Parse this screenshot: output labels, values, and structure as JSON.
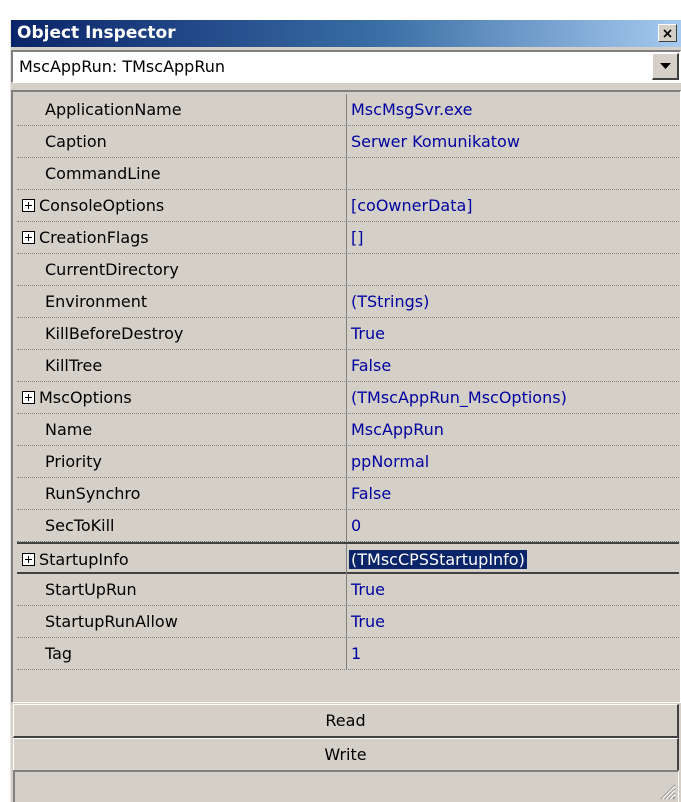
{
  "window": {
    "title": "Object Inspector"
  },
  "component_selector": {
    "value": "MscAppRun: TMscAppRun"
  },
  "properties": [
    {
      "name": "ApplicationName",
      "value": "MscMsgSvr.exe",
      "expandable": false
    },
    {
      "name": "Caption",
      "value": "Serwer Komunikatow",
      "expandable": false
    },
    {
      "name": "CommandLine",
      "value": "",
      "expandable": false
    },
    {
      "name": "ConsoleOptions",
      "value": "[coOwnerData]",
      "expandable": true
    },
    {
      "name": "CreationFlags",
      "value": "[]",
      "expandable": true
    },
    {
      "name": "CurrentDirectory",
      "value": "",
      "expandable": false
    },
    {
      "name": "Environment",
      "value": "(TStrings)",
      "expandable": false
    },
    {
      "name": "KillBeforeDestroy",
      "value": "True",
      "expandable": false
    },
    {
      "name": "KillTree",
      "value": "False",
      "expandable": false
    },
    {
      "name": "MscOptions",
      "value": "(TMscAppRun_MscOptions)",
      "expandable": true
    },
    {
      "name": "Name",
      "value": "MscAppRun",
      "expandable": false
    },
    {
      "name": "Priority",
      "value": "ppNormal",
      "expandable": false
    },
    {
      "name": "RunSynchro",
      "value": "False",
      "expandable": false
    },
    {
      "name": "SecToKill",
      "value": "0",
      "expandable": false
    },
    {
      "name": "StartupInfo",
      "value": "(TMscCPSStartupInfo)",
      "expandable": true,
      "selected": true
    },
    {
      "name": "StartUpRun",
      "value": "True",
      "expandable": false
    },
    {
      "name": "StartupRunAllow",
      "value": "True",
      "expandable": false
    },
    {
      "name": "Tag",
      "value": "1",
      "expandable": false
    }
  ],
  "buttons": {
    "read_label": "Read",
    "write_label": "Write"
  },
  "icons": {
    "close": "close-icon",
    "dropdown": "dropdown-arrow-icon",
    "expander": "plus-box-icon",
    "size_grip": "size-grip-icon"
  },
  "colors": {
    "title_gradient_start": "#0a246a",
    "title_gradient_end": "#a6caf0",
    "value_text": "#0000a0",
    "selection": "#0a246a",
    "face": "#d4d0c8"
  }
}
